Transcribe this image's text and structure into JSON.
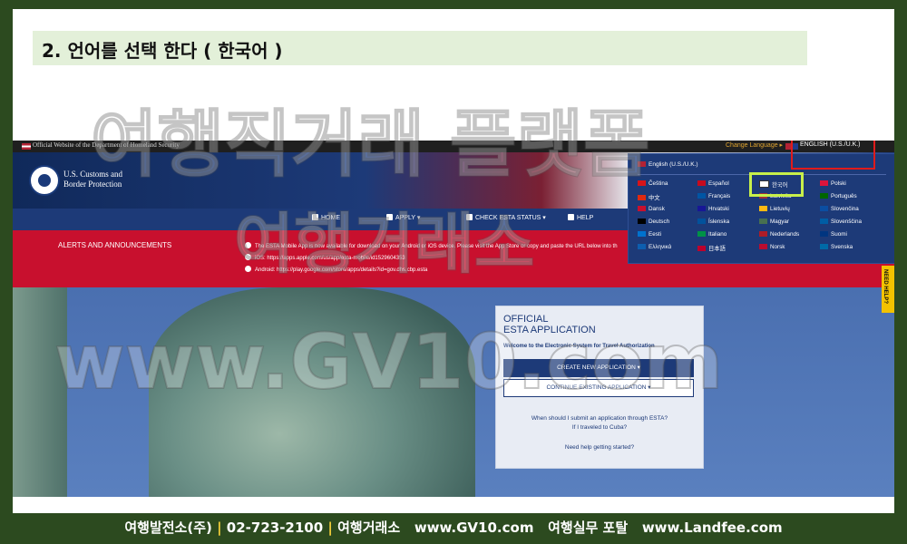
{
  "heading": "2. 언어를 선택 한다 ( 한국어 )",
  "gov_bar": {
    "official": "Official Website of the Department of Homeland Security",
    "change_language": "Change Language ▸",
    "current_language": "ENGLISH (U.S./U.K.)"
  },
  "agency": "U.S. Customs and\nBorder Protection",
  "nav": {
    "home": "HOME",
    "apply": "APPLY ▾",
    "check_status": "CHECK ESTA STATUS ▾",
    "help": "HELP"
  },
  "alerts": {
    "title": "ALERTS AND ANNOUNCEMENTS",
    "lines": [
      "The ESTA Mobile App is now available for download on your Android or iOS device. Please visit the App Store or copy and paste the URL below into th",
      "iOS: https://apps.apple.com/us/app/esta-mobile/id1529604353",
      "Android: https://play.google.com/store/apps/details?id=gov.dhs.cbp.esta"
    ]
  },
  "language_panel": {
    "english": "English (U.S./U.K.)",
    "languages": [
      "Čeština",
      "Español",
      "한국어",
      "Polski",
      "中文",
      "Français",
      "Latviešu",
      "Português",
      "Dansk",
      "Hrvatski",
      "Lietuvių",
      "Slovenčina",
      "Deutsch",
      "Íslenska",
      "Magyar",
      "Slovenščina",
      "Eesti",
      "Italiano",
      "Nederlands",
      "Suomi",
      "Ελληνικά",
      "日本語",
      "Norsk",
      "Svenska"
    ]
  },
  "need_help": "NEED HELP?",
  "esta": {
    "title": "OFFICIAL\nESTA APPLICATION",
    "welcome": "Welcome to the Electronic System for Travel Authorization",
    "create": "CREATE NEW APPLICATION ▾",
    "continue": "CONTINUE EXISTING APPLICATION ▾",
    "when": "When should I submit an application through ESTA?",
    "cuba": "If I traveled to Cuba?",
    "help_start": "Need help getting started?"
  },
  "watermarks": [
    "여행직거래 플랫폼",
    "여행거래소",
    "www.GV10.com"
  ],
  "footer": {
    "company": "여행발전소(주)",
    "phone": "02-723-2100",
    "exchange": "여행거래소",
    "site1": "www.GV10.com",
    "portal": "여행실무 포탈",
    "site2": "www.Landfee.com"
  },
  "colors": {
    "nav_blue": "#1d3a78",
    "alert_red": "#c8102e",
    "highlight_red": "#e01b1b",
    "highlight_yellow": "#c8f04a",
    "footer_sep": "#f6d03a"
  }
}
